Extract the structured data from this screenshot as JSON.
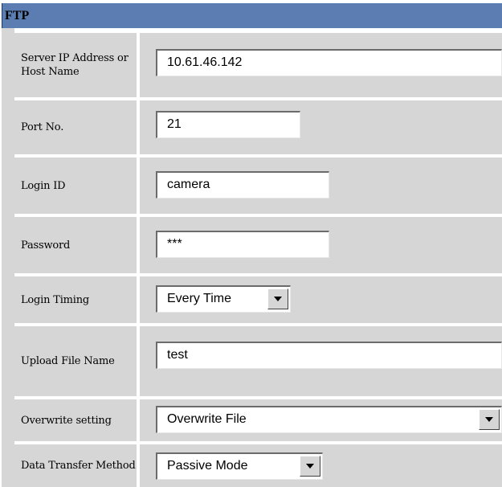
{
  "section": {
    "title": "FTP"
  },
  "fields": [
    {
      "label": "Server IP Address or Host Name",
      "value": "10.61.46.142"
    },
    {
      "label": "Port No.",
      "value": "21"
    },
    {
      "label": "Login ID",
      "value": "camera"
    },
    {
      "label": "Password",
      "value": "***"
    },
    {
      "label": "Login Timing",
      "value": "Every Time"
    },
    {
      "label": "Upload File Name",
      "value": "test"
    },
    {
      "label": "Overwrite setting",
      "value": "Overwrite File"
    },
    {
      "label": "Data Transfer Method",
      "value": "Passive Mode"
    }
  ],
  "colors": {
    "header": "#5b7db1",
    "row": "#d6d6d6"
  }
}
